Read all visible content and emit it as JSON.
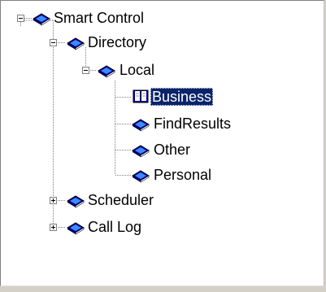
{
  "tree": {
    "root": {
      "label": "Smart Control",
      "expanded": true,
      "icon": "book-icon"
    },
    "directory": {
      "label": "Directory",
      "expanded": true,
      "icon": "book-icon"
    },
    "local": {
      "label": "Local",
      "expanded": true,
      "icon": "book-icon"
    },
    "business": {
      "label": "Business",
      "selected": true,
      "icon": "open-book-icon"
    },
    "findresults": {
      "label": "FindResults",
      "icon": "book-icon"
    },
    "other": {
      "label": "Other",
      "icon": "book-icon"
    },
    "personal": {
      "label": "Personal",
      "icon": "book-icon"
    },
    "scheduler": {
      "label": "Scheduler",
      "expanded": false,
      "icon": "book-icon"
    },
    "calllog": {
      "label": "Call Log",
      "expanded": false,
      "icon": "book-icon"
    }
  },
  "colors": {
    "selection_bg": "#0a246a",
    "book_cover": "#0000a8",
    "book_highlight": "#3c8cff"
  }
}
